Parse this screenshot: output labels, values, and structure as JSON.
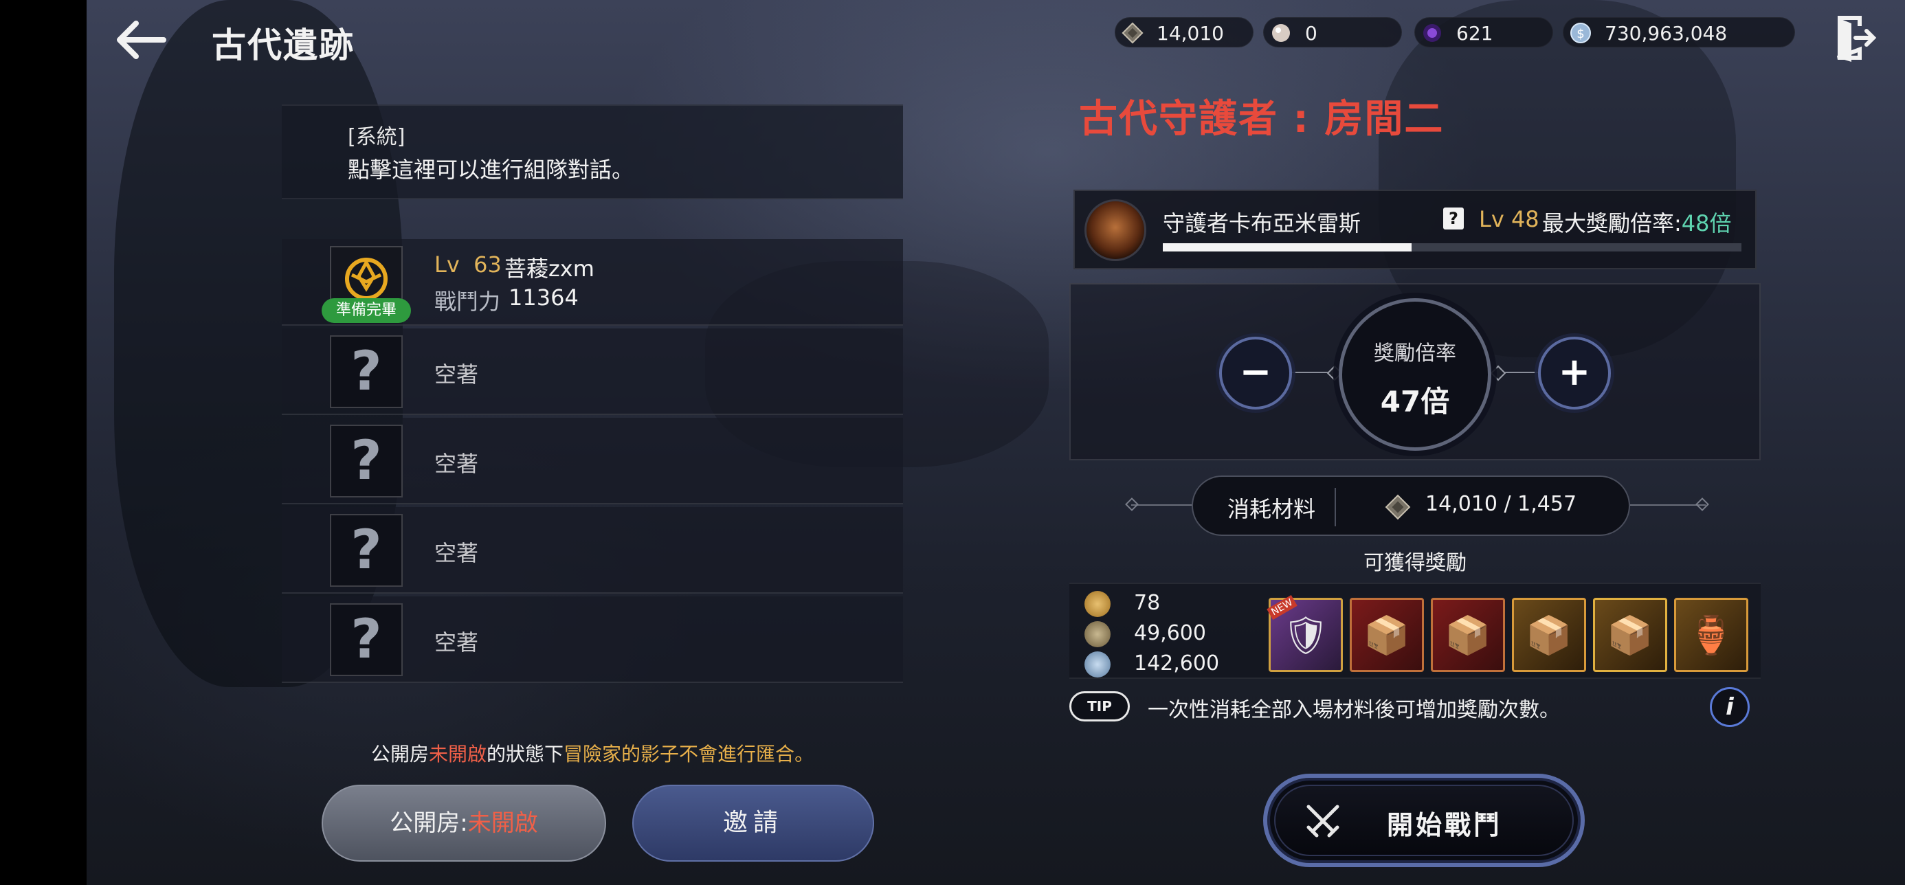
{
  "header": {
    "title": "古代遺跡",
    "currencies": [
      {
        "icon": "gem-token-icon",
        "value": "14,010"
      },
      {
        "icon": "pearl-icon",
        "value": "0"
      },
      {
        "icon": "purple-orb-icon",
        "value": "621"
      },
      {
        "icon": "silver-coin-icon",
        "value": "730,963,048"
      }
    ]
  },
  "system": {
    "tag": "[系統]",
    "message": "點擊這裡可以進行組隊對話。"
  },
  "party": {
    "member": {
      "lv_label": "Lv",
      "lv_value": "63",
      "name": "菩薐zxm",
      "cp_label": "戰鬥力",
      "cp_value": "11364",
      "status": "準備完畢"
    },
    "empty_label": "空著",
    "empty_slots": 4
  },
  "notice": {
    "p1": "公開房",
    "p2": "未開啟",
    "p3": "的狀態下",
    "p4": "冒險家的影子不會進行匯合",
    "p5": "。"
  },
  "buttons": {
    "public_label": "公開房:",
    "public_state": "未開啟",
    "invite": "邀請",
    "start": "開始戰鬥"
  },
  "dungeon": {
    "title": "古代守護者 : 房間二",
    "boss_name": "守護者卡布亞米雷斯",
    "boss_lv": "Lv 48",
    "max_mult_label": "最大獎勵倍率:",
    "max_mult_value": "48倍",
    "boss_progress": 0.43,
    "mult_label": "獎勵倍率",
    "mult_value": "47倍",
    "minus": "−",
    "plus": "+"
  },
  "material": {
    "label": "消耗材料",
    "value": "14,010 / 1,457"
  },
  "rewards": {
    "label": "可獲得獎勵",
    "rows": [
      {
        "icon": "gold-medal-icon",
        "value": "78"
      },
      {
        "icon": "exp-icon",
        "value": "49,600"
      },
      {
        "icon": "silver-coin-icon",
        "value": "142,600"
      }
    ],
    "new_tag": "NEW"
  },
  "tip": {
    "badge": "TIP",
    "text": "一次性消耗全部入場材料後可增加獎勵次數。",
    "info": "i"
  },
  "colors": {
    "accent_red": "#e84a3c",
    "gold": "#e2b45a",
    "teal": "#5fd4b0",
    "ready_green": "#2e9a3e",
    "button_blue": "#5a6ca8"
  }
}
